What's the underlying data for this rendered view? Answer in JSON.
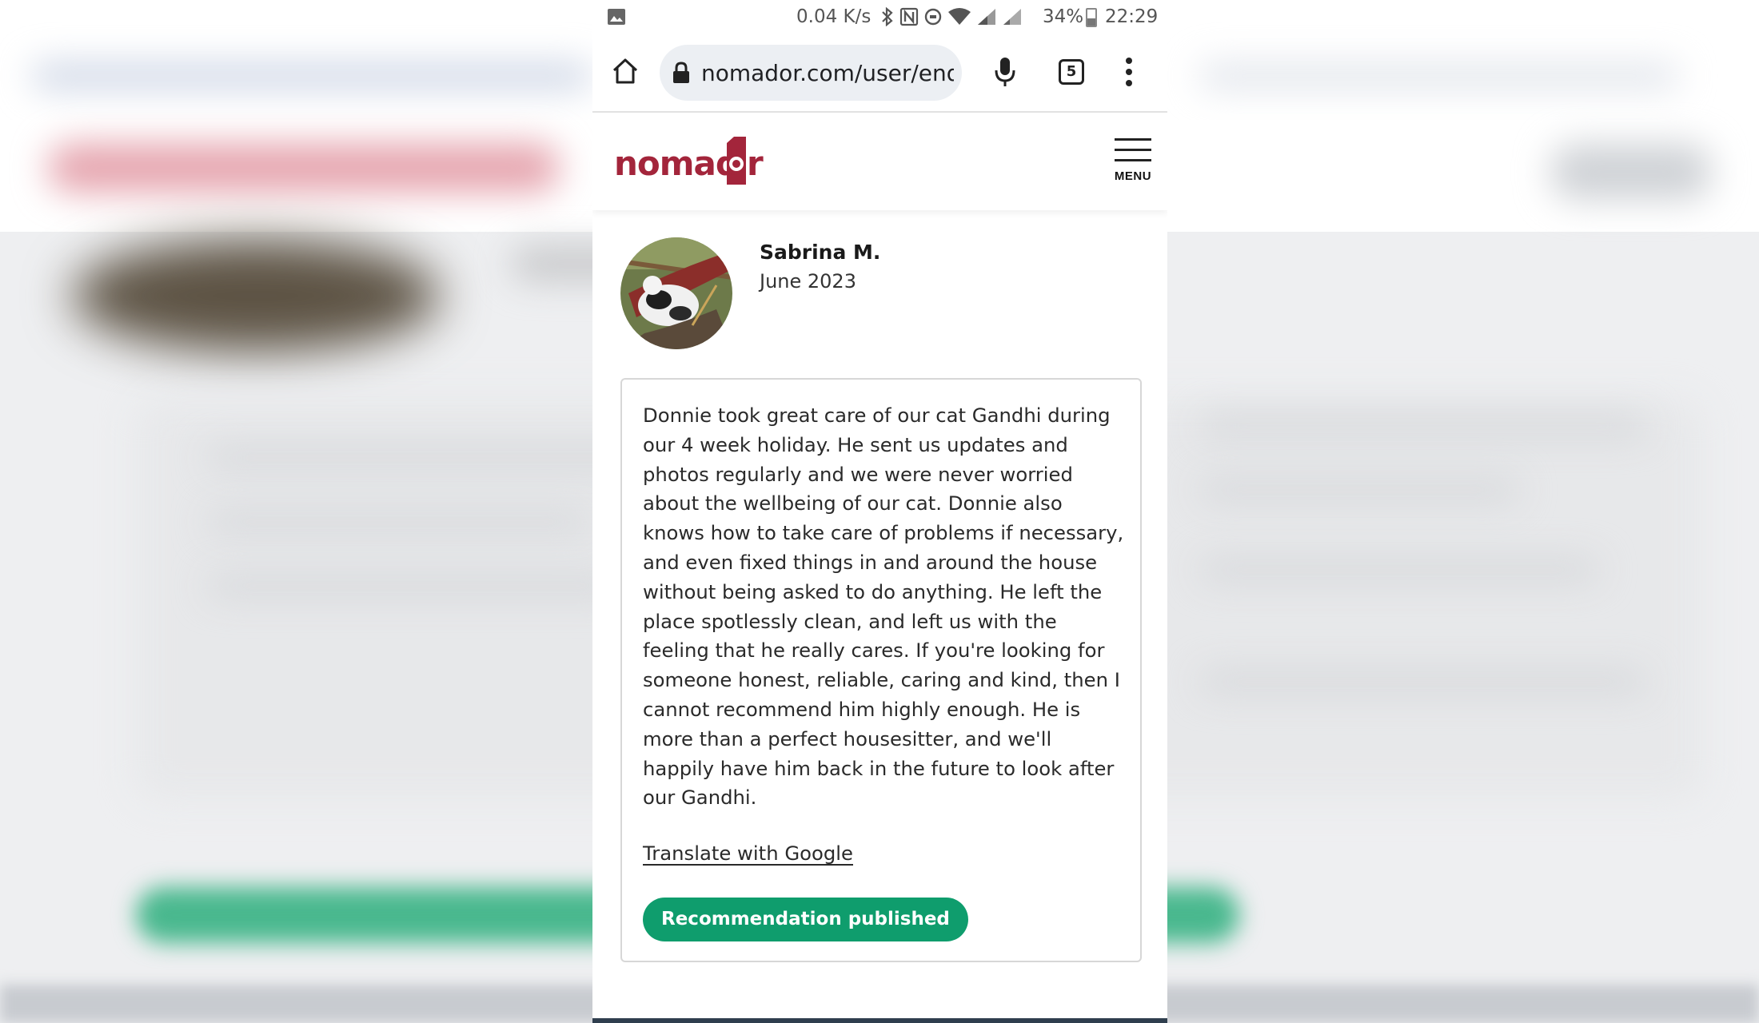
{
  "status_bar": {
    "net_speed": "0.04 K/s",
    "battery": "34%",
    "time": "22:29"
  },
  "browser": {
    "url": "nomador.com/user/endc",
    "tab_count": "5"
  },
  "site": {
    "logo_text": "nomador",
    "menu_label": "MENU",
    "brand_color": "#a3253b"
  },
  "review": {
    "author": "Sabrina M.",
    "date": "June 2023",
    "text": "Donnie took great care of our cat Gandhi during our 4 week holiday. He sent us updates and photos regularly and we were never worried about the wellbeing of our cat. Donnie also knows how to take care of problems if necessary, and even fixed things in and around the house without being asked to do anything. He left the place spotlessly clean, and left us with the feeling that he really cares. If you're looking for someone honest, reliable, caring and kind, then I cannot recommend him highly enough. He is more than a perfect housesitter, and we'll happily have him back in the future to look after our Gandhi.",
    "translate_link": "Translate with Google",
    "status_badge": "Recommendation published",
    "badge_color": "#0f9d6d"
  }
}
